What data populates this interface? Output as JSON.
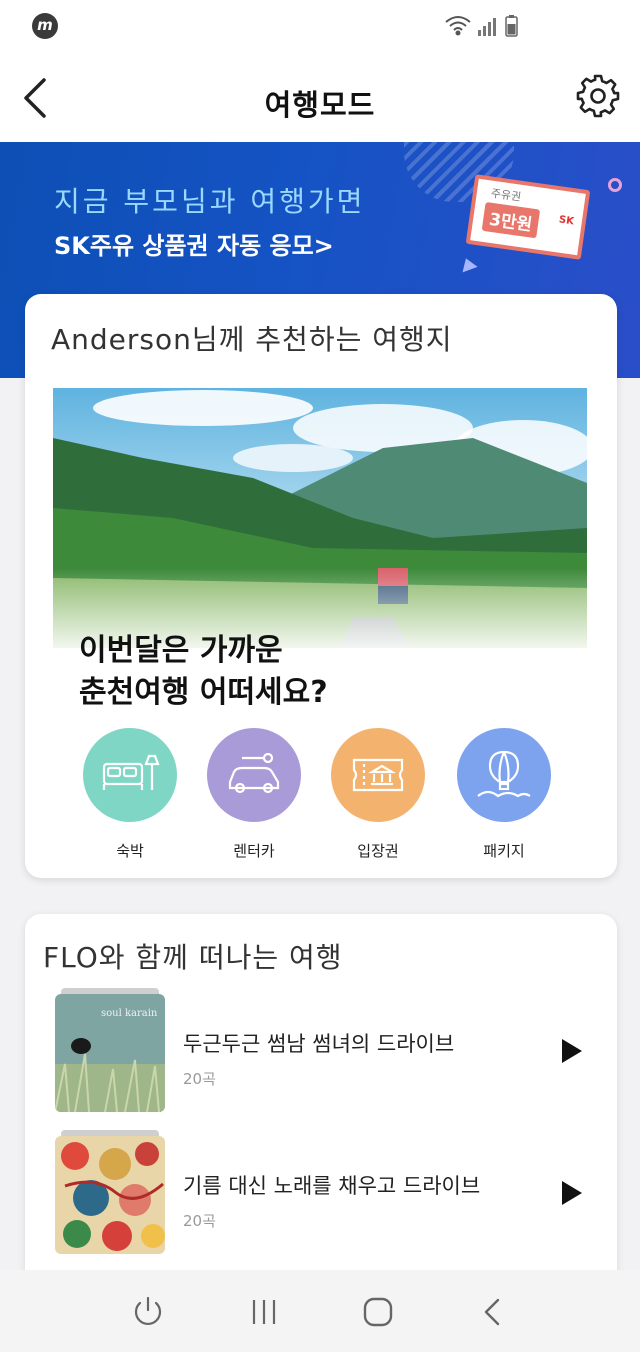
{
  "status_bar": {
    "logo_text": "m"
  },
  "header": {
    "title": "여행모드"
  },
  "banner": {
    "line1": "지금 부모님과 여행가면",
    "line2": "SK주유 상품권 자동 응모>",
    "coupon_small": "주유권",
    "coupon_big": "3만원",
    "coupon_brand": "SK",
    "accent_color": "#9ad9ff",
    "background_color": "#1553c4"
  },
  "recommend": {
    "title": "Anderson님께 추천하는 여행지",
    "caption_line1": "이번달은 가까운",
    "caption_line2": "춘천여행 어떠세요?",
    "categories": [
      {
        "label": "숙박",
        "icon": "bed-icon",
        "color": "#7fd6c4"
      },
      {
        "label": "렌터카",
        "icon": "car-icon",
        "color": "#a99bd8"
      },
      {
        "label": "입장권",
        "icon": "ticket-icon",
        "color": "#f3b36e"
      },
      {
        "label": "패키지",
        "icon": "balloon-icon",
        "color": "#7da2ee"
      }
    ]
  },
  "flo": {
    "title": "FLO와 함께 떠나는 여행",
    "playlists": [
      {
        "name": "두근두근 썸남 썸녀의 드라이브",
        "count": "20곡",
        "album_text": "soul karain"
      },
      {
        "name": "기름 대신 노래를 채우고 드라이브",
        "count": "20곡"
      }
    ]
  },
  "nav": {
    "buttons": [
      "power-icon",
      "recents-icon",
      "home-icon",
      "back-icon"
    ]
  }
}
